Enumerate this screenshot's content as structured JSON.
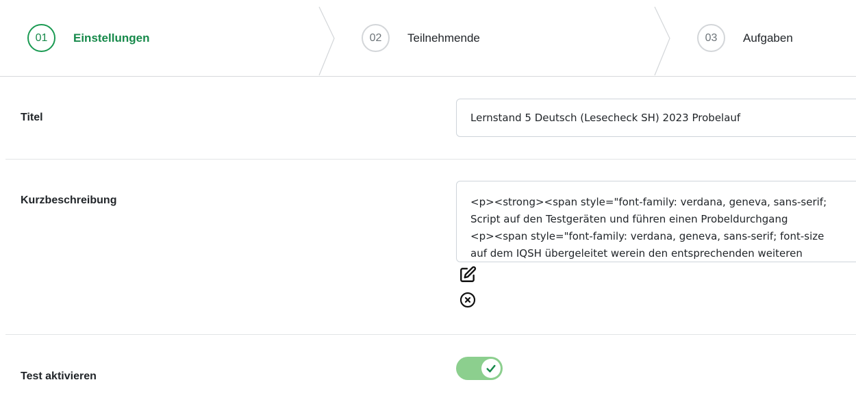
{
  "stepper": {
    "steps": [
      {
        "number": "01",
        "label": "Einstellungen",
        "active": true
      },
      {
        "number": "02",
        "label": "Teilnehmende",
        "active": false
      },
      {
        "number": "03",
        "label": "Aufgaben",
        "active": false
      }
    ]
  },
  "form": {
    "title": {
      "label": "Titel",
      "value": "Lernstand 5 Deutsch (Lesecheck SH) 2023 Probelauf"
    },
    "description": {
      "label": "Kurzbeschreibung",
      "lines": [
        "<p><strong><span style=\"font-family: verdana, geneva, sans-serif;",
        "Script auf den Testgeräten und führen einen Probeldurchgang",
        "<p><span style=\"font-family: verdana, geneva, sans-serif; font-size",
        "auf dem IQSH übergeleitet werein den entsprechenden weiteren"
      ],
      "edit_icon": "edit-icon",
      "clear_icon": "close-circle-icon"
    },
    "activate": {
      "label": "Test aktivieren",
      "enabled": true
    }
  },
  "colors": {
    "accent": "#16894a",
    "toggle_on": "#8ccf8e",
    "border": "#ced4da"
  }
}
